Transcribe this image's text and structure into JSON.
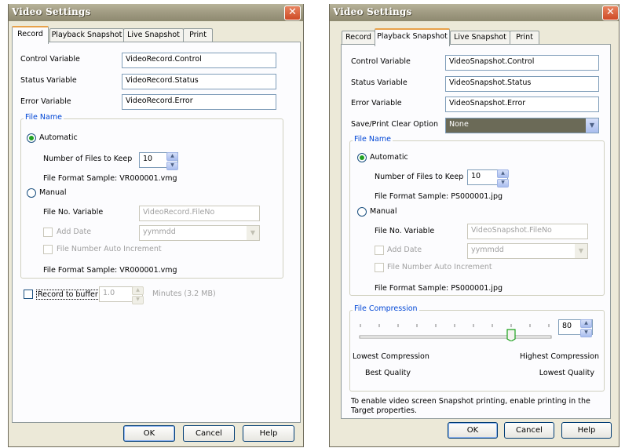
{
  "left": {
    "title": "Video Settings",
    "tabs": [
      "Record",
      "Playback Snapshot",
      "Live Snapshot",
      "Print"
    ],
    "active_tab": "Record",
    "fields": [
      {
        "label": "Control Variable",
        "value": "VideoRecord.Control"
      },
      {
        "label": "Status Variable",
        "value": "VideoRecord.Status"
      },
      {
        "label": "Error Variable",
        "value": "VideoRecord.Error"
      }
    ],
    "file_name": {
      "legend": "File Name",
      "automatic": "Automatic",
      "num_files_label": "Number of Files to Keep",
      "num_files_value": "10",
      "format_sample_auto": "File Format Sample: VR000001.vmg",
      "manual": "Manual",
      "file_no_label": "File No. Variable",
      "file_no_value": "VideoRecord.FileNo",
      "add_date": "Add Date",
      "date_format": "yymmdd",
      "auto_increment": "File Number Auto Increment",
      "format_sample_manual": "File Format Sample: VR000001.vmg"
    },
    "record_buffer": {
      "label": "Record to buffer",
      "value": "1.0",
      "unit": "Minutes (3.2 MB)"
    },
    "buttons": {
      "ok": "OK",
      "cancel": "Cancel",
      "help": "Help"
    }
  },
  "right": {
    "title": "Video Settings",
    "tabs": [
      "Record",
      "Playback Snapshot",
      "Live Snapshot",
      "Print"
    ],
    "active_tab": "Playback Snapshot",
    "fields": [
      {
        "label": "Control Variable",
        "value": "VideoSnapshot.Control"
      },
      {
        "label": "Status Variable",
        "value": "VideoSnapshot.Status"
      },
      {
        "label": "Error Variable",
        "value": "VideoSnapshot.Error"
      }
    ],
    "clear_option": {
      "label": "Save/Print Clear Option",
      "value": "None"
    },
    "file_name": {
      "legend": "File Name",
      "automatic": "Automatic",
      "num_files_label": "Number of Files to Keep",
      "num_files_value": "10",
      "format_sample_auto": "File Format Sample: PS000001.jpg",
      "manual": "Manual",
      "file_no_label": "File No. Variable",
      "file_no_value": "VideoSnapshot.FileNo",
      "add_date": "Add Date",
      "date_format": "yymmdd",
      "auto_increment": "File Number Auto Increment",
      "format_sample_manual": "File Format Sample: PS000001.jpg"
    },
    "compression": {
      "legend": "File Compression",
      "value": "80",
      "low_label": "Lowest Compression",
      "high_label": "Highest Compression",
      "best_quality": "Best Quality",
      "lowest_quality": "Lowest Quality"
    },
    "note": "To enable video screen Snapshot printing, enable printing in the Target properties.",
    "buttons": {
      "ok": "OK",
      "cancel": "Cancel",
      "help": "Help"
    }
  },
  "colors": {
    "group_legend": "#0046d5",
    "active_tab_accent": "#e8a14a",
    "close_button": "#cf4a26",
    "combo_selected": "#6b6a57"
  }
}
